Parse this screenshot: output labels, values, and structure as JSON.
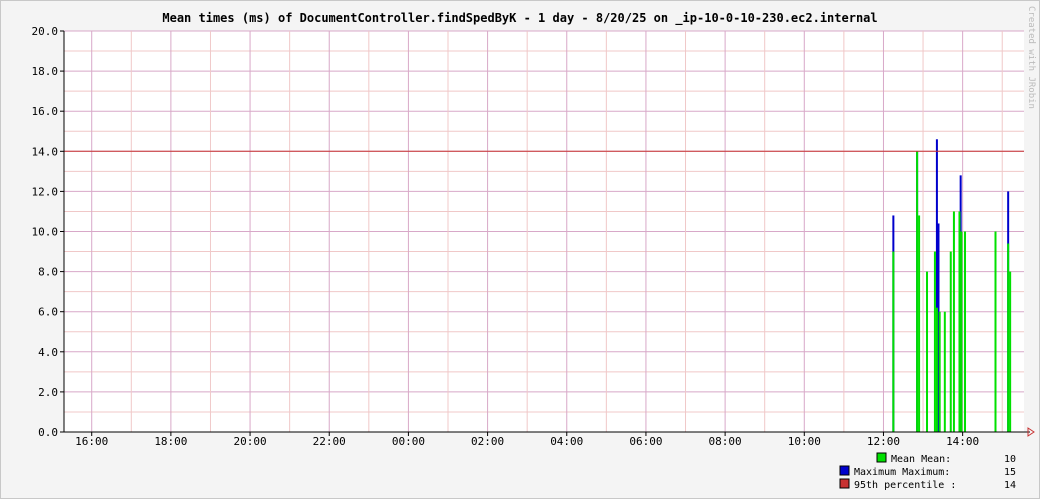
{
  "chart_data": {
    "type": "bar",
    "title": "Mean times (ms) of DocumentController.findSpedByK - 1 day - 8/20/25 on _ip-10-0-10-230.ec2.internal",
    "watermark": "Created with JRobin",
    "x_tick_labels": [
      "16:00",
      "18:00",
      "20:00",
      "22:00",
      "00:00",
      "02:00",
      "04:00",
      "06:00",
      "08:00",
      "10:00",
      "12:00",
      "14:00"
    ],
    "y_tick_labels": [
      "0.0",
      "2.0",
      "4.0",
      "6.0",
      "8.0",
      "10.0",
      "12.0",
      "14.0",
      "16.0",
      "18.0",
      "20.0"
    ],
    "ylim": [
      0,
      20
    ],
    "x_range_hours": [
      15.3,
      39.55
    ],
    "grid": true,
    "percentile_line": 14,
    "colors": {
      "mean": "#00e000",
      "maximum": "#0000cc",
      "percentile": "#c83232",
      "grid_major": "#d8a8c8",
      "grid_minor": "#f0c8c8"
    },
    "series": [
      {
        "name": "Mean",
        "points": [
          {
            "x": 36.25,
            "y": 9.0
          },
          {
            "x": 36.85,
            "y": 14.0
          },
          {
            "x": 36.9,
            "y": 10.8
          },
          {
            "x": 37.1,
            "y": 8.0
          },
          {
            "x": 37.3,
            "y": 9.0
          },
          {
            "x": 37.35,
            "y": 6.2
          },
          {
            "x": 37.42,
            "y": 6.0
          },
          {
            "x": 37.55,
            "y": 6.0
          },
          {
            "x": 37.7,
            "y": 9.0
          },
          {
            "x": 37.78,
            "y": 11.0
          },
          {
            "x": 37.92,
            "y": 11.0
          },
          {
            "x": 37.97,
            "y": 10.0
          },
          {
            "x": 38.06,
            "y": 10.0
          },
          {
            "x": 38.83,
            "y": 10.0
          },
          {
            "x": 39.15,
            "y": 9.4
          },
          {
            "x": 39.2,
            "y": 8.0
          }
        ]
      },
      {
        "name": "Maximum",
        "points": [
          {
            "x": 36.25,
            "y": 10.8
          },
          {
            "x": 36.85,
            "y": 14.0
          },
          {
            "x": 37.35,
            "y": 14.6
          },
          {
            "x": 37.39,
            "y": 10.4
          },
          {
            "x": 37.95,
            "y": 12.8
          },
          {
            "x": 39.15,
            "y": 12.0
          }
        ]
      }
    ],
    "legend": [
      {
        "name": "Mean",
        "label": "Mean  Mean:",
        "value": "10"
      },
      {
        "name": "Maximum",
        "label": "Maximum  Maximum:",
        "value": "15"
      },
      {
        "name": "95th percentile",
        "label": "95th percentile  :",
        "value": "14"
      }
    ]
  }
}
